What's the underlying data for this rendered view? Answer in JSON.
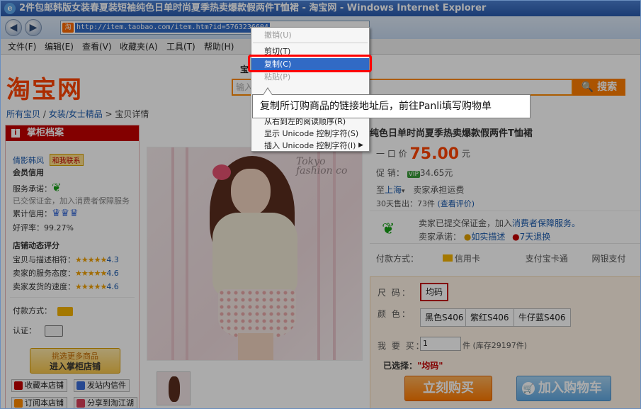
{
  "window": {
    "title": "2件包邮韩版女装春夏装短袖纯色日单时尚夏季热卖爆款假两件T恤裙 - 淘宝网 - Windows Internet Explorer",
    "ie_icon": "e"
  },
  "navbar": {
    "back_glyph": "◀",
    "forward_glyph": "▶",
    "favicon_text": "淘",
    "url": "http://item.taobao.com/item.htm?id=5763236604"
  },
  "menubar": {
    "items": [
      "文件(F)",
      "编辑(E)",
      "查看(V)",
      "收藏夹(A)",
      "工具(T)",
      "帮助(H)"
    ]
  },
  "page": {
    "logo": "淘宝网",
    "search_tab": "宝",
    "search_placeholder": "输入",
    "search_button": "搜索",
    "breadcrumb": {
      "home": "所有宝贝",
      "sep1": " / ",
      "category": "女装/女士精品",
      "sep2": " > ",
      "current": "宝贝详情"
    },
    "shop": {
      "header": "掌柜档案",
      "header_icon": "i",
      "seller_name": "倩影韩风",
      "contact": "和我联系",
      "credit_title": "会员信用",
      "promise_label": "服务承诺：",
      "deposit_text": "已交保证金，加入消费者保障服务",
      "credit_label": "累计信用：",
      "rating_label": "好评率：99.27%",
      "dynamic_title": "店铺动态评分",
      "scores": [
        {
          "label": "宝贝与描述相符：",
          "stars": "★★★★★",
          "value": "4.3"
        },
        {
          "label": "卖家的服务态度：",
          "stars": "★★★★★",
          "value": "4.6"
        },
        {
          "label": "卖家发货的速度：",
          "stars": "★★★★★",
          "value": "4.6"
        }
      ],
      "pay_label": "付款方式：",
      "auth_label": "认证：",
      "enter_line1": "挑选更多商品",
      "enter_line2": "进入掌柜店铺",
      "btn_collect": "收藏本店铺",
      "btn_message": "发站内信件",
      "btn_subscribe": "订阅本店铺",
      "btn_share": "分享到淘江湖"
    },
    "image_text": {
      "line1": "Tokyo",
      "line2": "fashion co"
    },
    "product": {
      "title": "纯色日单时尚夏季热卖爆款假两件T恤裙",
      "price_label": "一 口 价",
      "price": "75.00",
      "price_unit": "元",
      "promo_label": "促    销：",
      "vip": "VIP",
      "promo_price": "34.65元",
      "ship_to": "至",
      "ship_city": "上海",
      "ship_fee": "卖家承担运费",
      "sales": "30天售出：73件",
      "reviews": "(查看评价)",
      "guarantee_prefix": "卖家已提交保证金，加入",
      "guarantee_link": "消费者保障服务。",
      "promise_label": "卖家承诺：",
      "promise_1": "如实描述",
      "promise_2": "7天退换",
      "pay_label": "付款方式：",
      "pay_1": "信用卡",
      "pay_2": "支付宝卡通",
      "pay_3": "网银支付"
    },
    "sku": {
      "size_label": "尺    码：",
      "size_value": "均码",
      "color_label": "颜    色：",
      "colors": [
        "黑色S406",
        "紫红S406",
        "牛仔蓝S406"
      ],
      "qty_label": "我 要 买：",
      "qty_value": "1",
      "stock": "件 (库存29197件)",
      "selected_label": "已选择：",
      "selected_value": "\"均码\"",
      "buy_now": "立刻购买",
      "add_cart": "加入购物车",
      "cart_icon": "🛒"
    }
  },
  "context_menu": {
    "items": [
      {
        "label": "撤销(U)",
        "disabled": true
      },
      {
        "label": "剪切(T)",
        "disabled": false
      },
      {
        "label": "复制(C)",
        "disabled": false,
        "selected": true
      },
      {
        "label": "粘贴(P)",
        "disabled": true
      },
      {
        "label": "从右到左的阅读顺序(R)",
        "disabled": false
      },
      {
        "label": "显示 Unicode 控制字符(S)",
        "disabled": false
      },
      {
        "label": "插入 Unicode 控制字符(I)",
        "disabled": false,
        "submenu": true
      }
    ],
    "submenu_arrow": "▶"
  },
  "tooltip": {
    "text": "复制所订购商品的链接地址后，前往Panli填写购物单"
  },
  "colors": {
    "accent_highlight": "#ff0000",
    "selection": "#316ac5",
    "taobao_orange": "#ff4400",
    "shop_red": "#c40000"
  }
}
